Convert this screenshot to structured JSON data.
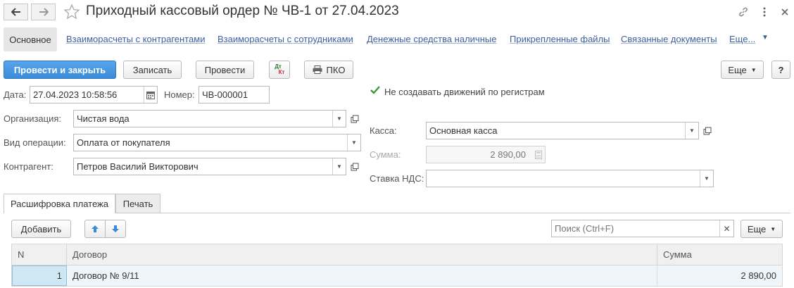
{
  "window": {
    "title": "Приходный кассовый ордер № ЧВ-1 от 27.04.2023"
  },
  "nav_tabs": {
    "main": "Основное",
    "links": [
      "Взаиморасчеты с контрагентами",
      "Взаиморасчеты с сотрудниками",
      "Денежные средства наличные",
      "Прикрепленные файлы",
      "Связанные документы"
    ],
    "more": "Еще..."
  },
  "toolbar": {
    "post_close": "Провести и закрыть",
    "save": "Записать",
    "post": "Провести",
    "dtkt_top": "Дт",
    "dtkt_bottom": "Кт",
    "pko": "ПКО",
    "more": "Еще",
    "help": "?"
  },
  "form": {
    "date_label": "Дата:",
    "date_value": "27.04.2023 10:58:56",
    "number_label": "Номер:",
    "number_value": "ЧВ-000001",
    "no_movements_label": "Не создавать движений по регистрам",
    "no_movements_checked": true,
    "org_label": "Организация:",
    "org_value": "Чистая вода",
    "op_label": "Вид операции:",
    "op_value": "Оплата от покупателя",
    "counterparty_label": "Контрагент:",
    "counterparty_value": "Петров Василий Викторович",
    "cash_label": "Касса:",
    "cash_value": "Основная касса",
    "amount_label": "Сумма:",
    "amount_value": "2 890,00",
    "vat_label": "Ставка НДС:",
    "vat_value": ""
  },
  "table_tabs": [
    "Расшифровка платежа",
    "Печать"
  ],
  "table_toolbar": {
    "add": "Добавить",
    "search_placeholder": "Поиск (Ctrl+F)",
    "more": "Еще"
  },
  "table": {
    "columns": [
      "N",
      "Договор",
      "Сумма"
    ],
    "rows": [
      {
        "n": "1",
        "contract": "Договор № 9/11",
        "amount": "2 890,00"
      }
    ]
  },
  "colors": {
    "primary": "#3a8ad8",
    "link": "#3d5f9e",
    "check": "#3c9a3c",
    "arrow": "#3a8ad8"
  }
}
